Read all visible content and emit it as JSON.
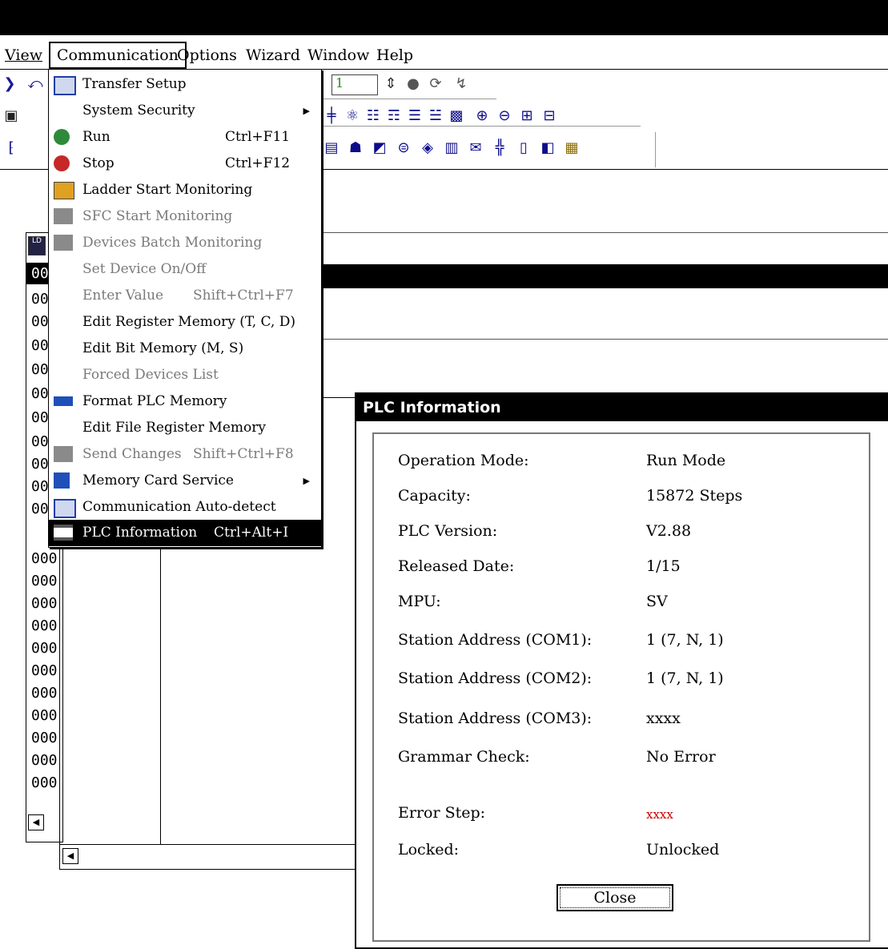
{
  "menubar": {
    "items": [
      {
        "label": "View",
        "underline": "V"
      },
      {
        "label": "Communication"
      },
      {
        "label": "Options"
      },
      {
        "label": "Wizard"
      },
      {
        "label": "Window"
      },
      {
        "label": "Help"
      }
    ]
  },
  "toolbar": {
    "step_value": "1"
  },
  "left_panel": {
    "rows": [
      "00",
      "00",
      "00",
      "00",
      "00",
      "00",
      "00",
      "00",
      "00",
      "00",
      "00",
      "000",
      "000",
      "000",
      "000",
      "000",
      "000",
      "000",
      "000",
      "000",
      "000",
      "000"
    ]
  },
  "dropdown": {
    "items": [
      {
        "label": "Transfer Setup",
        "shortcut": "",
        "state": "enabled",
        "icon": "transfer-setup-icon"
      },
      {
        "label": "System Security",
        "shortcut": "",
        "state": "enabled",
        "submenu": true
      },
      {
        "label": "Run",
        "shortcut": "Ctrl+F11",
        "state": "enabled",
        "icon": "run-icon"
      },
      {
        "label": "Stop",
        "shortcut": "Ctrl+F12",
        "state": "enabled",
        "icon": "stop-icon"
      },
      {
        "label": "Ladder Start Monitoring",
        "shortcut": "",
        "state": "enabled",
        "icon": "ladder-monitor-icon"
      },
      {
        "label": "SFC Start Monitoring",
        "shortcut": "",
        "state": "disabled",
        "icon": "sfc-monitor-icon"
      },
      {
        "label": "Devices Batch Monitoring",
        "shortcut": "",
        "state": "disabled",
        "icon": "batch-monitor-icon"
      },
      {
        "label": "Set Device On/Off",
        "shortcut": "",
        "state": "disabled"
      },
      {
        "label": "Enter Value",
        "shortcut": "Shift+Ctrl+F7",
        "state": "disabled"
      },
      {
        "label": "Edit Register Memory (T, C, D)",
        "shortcut": "",
        "state": "enabled"
      },
      {
        "label": "Edit Bit Memory (M, S)",
        "shortcut": "",
        "state": "enabled"
      },
      {
        "label": "Forced Devices List",
        "shortcut": "",
        "state": "disabled"
      },
      {
        "label": "Format PLC Memory",
        "shortcut": "",
        "state": "enabled",
        "icon": "format-memory-icon"
      },
      {
        "label": "Edit File Register Memory",
        "shortcut": "",
        "state": "enabled"
      },
      {
        "label": "Send Changes",
        "shortcut": "Shift+Ctrl+F8",
        "state": "disabled",
        "icon": "send-changes-icon"
      },
      {
        "label": "Memory Card Service",
        "shortcut": "",
        "state": "enabled",
        "submenu": true,
        "icon": "memory-card-icon"
      },
      {
        "label": "Communication Auto-detect",
        "shortcut": "",
        "state": "enabled",
        "icon": "auto-detect-icon"
      },
      {
        "label": "PLC Information",
        "shortcut": "Ctrl+Alt+I",
        "state": "selected",
        "icon": "plc-info-icon"
      }
    ]
  },
  "dialog": {
    "title": "PLC Information",
    "rows": [
      {
        "label": "Operation Mode:",
        "value": "Run Mode"
      },
      {
        "label": "Capacity:",
        "value": "15872 Steps"
      },
      {
        "label": "PLC Version:",
        "value": "V2.88"
      },
      {
        "label": "Released Date:",
        "value": "1/15"
      },
      {
        "label": "MPU:",
        "value": "SV"
      },
      {
        "label": "Station Address (COM1):",
        "value": "1 (7, N, 1)"
      },
      {
        "label": "Station Address (COM2):",
        "value": "1 (7, N, 1)"
      },
      {
        "label": "Station Address (COM3):",
        "value": "xxxx"
      },
      {
        "label": "Grammar Check:",
        "value": "No Error"
      },
      {
        "label": "Error Step:",
        "value": "xxxx"
      },
      {
        "label": "Locked:",
        "value": "Unlocked"
      }
    ],
    "close_label": "Close",
    "error_color": "#cc0000"
  }
}
